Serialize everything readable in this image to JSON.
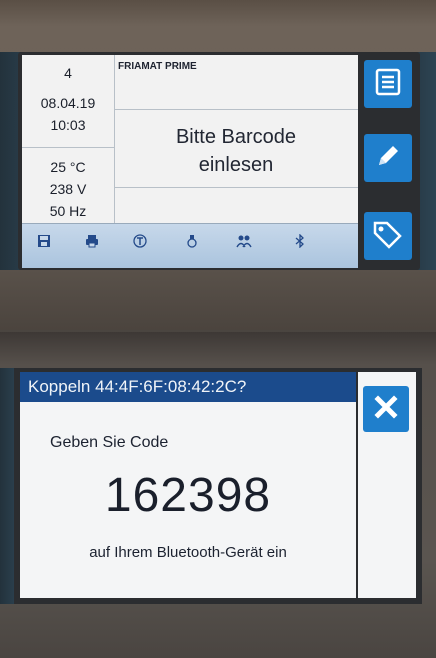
{
  "screen1": {
    "status": {
      "channel": "4",
      "date": "08.04.19",
      "time": "10:03",
      "temperature": "25 °C",
      "voltage": "238  V",
      "frequency": "50  Hz"
    },
    "device_title": "FRIAMAT PRIME",
    "message_line1": "Bitte Barcode",
    "message_line2": "einlesen",
    "side_buttons": [
      "menu-icon",
      "edit-pencil-icon",
      "tag-icon"
    ],
    "status_icons": [
      "save-icon",
      "printer-icon",
      "temperature-t-icon",
      "tool-icon",
      "users-icon",
      "bluetooth-icon"
    ]
  },
  "screen2": {
    "title": "Koppeln 44:4F:6F:08:42:2C?",
    "instruction": "Geben Sie Code",
    "code": "162398",
    "instruction2": "auf Ihrem Bluetooth-Gerät ein",
    "close_icon": "close-x-icon"
  },
  "colors": {
    "accent_button": "#1f7fcc",
    "title_bar": "#1b4b8c",
    "status_bar": "#b8cfe6"
  }
}
